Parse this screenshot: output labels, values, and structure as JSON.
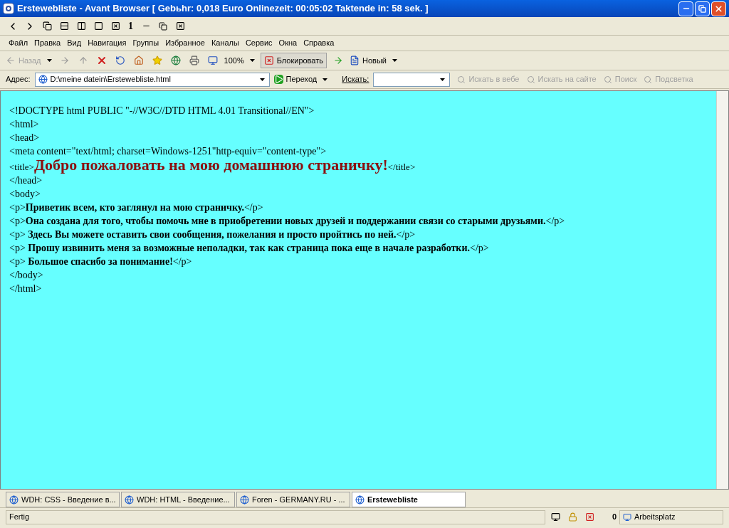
{
  "window": {
    "title": "Erstewebliste - Avant Browser [ Gebьhr: 0,018 Euro Onlinezeit: 00:05:02 Taktende in: 58 sek. ]"
  },
  "window_toolbar": {
    "number_button": "1"
  },
  "menu": [
    "Файл",
    "Правка",
    "Вид",
    "Навигация",
    "Группы",
    "Избранное",
    "Каналы",
    "Сервис",
    "Окна",
    "Справка"
  ],
  "toolbar": {
    "back": {
      "label": "Назад",
      "disabled": true
    },
    "zoom": "100%",
    "block": {
      "label": "Блокировать",
      "selected": true
    },
    "new": "Новый"
  },
  "address_bar": {
    "label": "Адрес:",
    "value": "D:\\meine datein\\Erstewebliste.html",
    "go": "Переход",
    "search_label": "Искать:",
    "search_buttons": [
      {
        "label": "Искать в вебе",
        "disabled": true
      },
      {
        "label": "Искать на сайте",
        "disabled": true
      },
      {
        "label": "Поиск",
        "disabled": true
      },
      {
        "label": "Подсветка",
        "disabled": true
      }
    ]
  },
  "page_lines": [
    [
      {
        "kind": "plain",
        "text": "<!DOCTYPE html PUBLIC \"-//W3C//DTD HTML 4.01 Transitional//EN\">"
      }
    ],
    [
      {
        "kind": "plain",
        "text": "<html>"
      }
    ],
    [
      {
        "kind": "plain",
        "text": "<head>"
      }
    ],
    [
      {
        "kind": "plain",
        "text": "<meta content=\"text/html; charset=Windows-1251\"http-equiv=\"content-type\">"
      }
    ],
    [
      {
        "kind": "small",
        "text": "<title>"
      },
      {
        "kind": "heading",
        "text": "Добро пожаловать на мою домашнюю страничку!"
      },
      {
        "kind": "small",
        "text": "</title>"
      }
    ],
    [
      {
        "kind": "plain",
        "text": "</head>"
      }
    ],
    [
      {
        "kind": "plain",
        "text": "<body>"
      }
    ],
    [
      {
        "kind": "plain",
        "text": "<p>"
      },
      {
        "kind": "bold",
        "text": "Приветик всем, кто заглянул на мою страничку."
      },
      {
        "kind": "plain",
        "text": "</p>"
      }
    ],
    [
      {
        "kind": "plain",
        "text": "<p>"
      },
      {
        "kind": "bold",
        "text": "Она создана для того, чтобы помочь мне в приобретении новых друзей и поддержании связи со старыми друзьями."
      },
      {
        "kind": "plain",
        "text": "</p>"
      }
    ],
    [
      {
        "kind": "plain",
        "text": "<p>"
      },
      {
        "kind": "bold",
        "text": " Здесь Вы можете оставить свои сообщения, пожелания и просто пройтись по ней."
      },
      {
        "kind": "plain",
        "text": "</p>"
      }
    ],
    [
      {
        "kind": "plain",
        "text": "<p>"
      },
      {
        "kind": "bold",
        "text": " Прошу извинить меня за возможные неполадки, так как страница пока еще в начале разработки."
      },
      {
        "kind": "plain",
        "text": "</p>"
      }
    ],
    [
      {
        "kind": "plain",
        "text": "<p>"
      },
      {
        "kind": "bold",
        "text": " Большое спасибо за понимание!"
      },
      {
        "kind": "plain",
        "text": "</p>"
      }
    ],
    [
      {
        "kind": "plain",
        "text": "</body>"
      }
    ],
    [
      {
        "kind": "plain",
        "text": "</html>"
      }
    ]
  ],
  "tabs": [
    {
      "label": "WDH: CSS - Введение в...",
      "selected": false
    },
    {
      "label": "WDH: HTML - Введение...",
      "selected": false
    },
    {
      "label": "Foren - GERMANY.RU - ...",
      "selected": false
    },
    {
      "label": "Erstewebliste",
      "selected": true
    }
  ],
  "status_bar": {
    "text": "Fertig",
    "count": "0",
    "zone": "Arbeitsplatz"
  }
}
